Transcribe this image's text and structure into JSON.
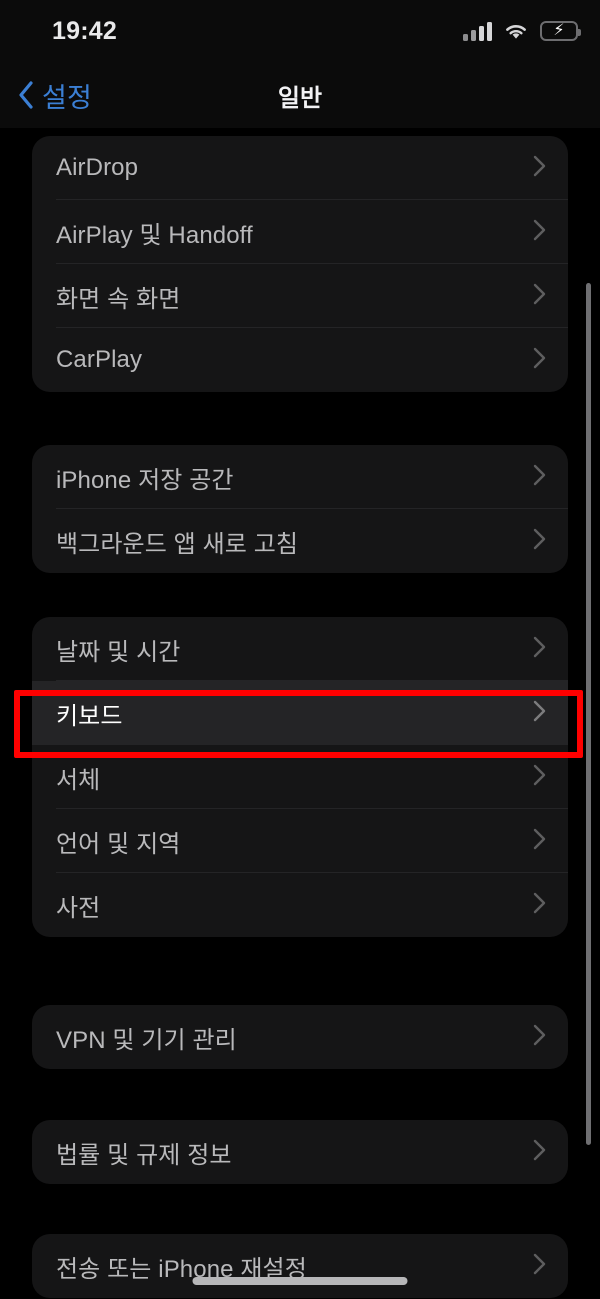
{
  "status_bar": {
    "time": "19:42",
    "cellular_icon": "cellular-bars-icon",
    "cellular_bars": 3,
    "wifi_icon": "wifi-icon",
    "battery_icon": "battery-charging-icon",
    "battery_level_percent": 88,
    "battery_charging": true,
    "battery_color": "#34c759"
  },
  "nav_bar": {
    "back_icon": "chevron-left-icon",
    "back_label": "설정",
    "title": "일반",
    "accent_color": "#3b7fd4"
  },
  "annotation": {
    "type": "red-rectangle-highlight",
    "target_row": "키보드",
    "color": "#ff0000"
  },
  "chevron_icon": "chevron-right-icon",
  "groups": [
    {
      "name": "connectivity-group",
      "rows": [
        {
          "label": "AirDrop",
          "highlighted": false
        },
        {
          "label": "AirPlay 및 Handoff",
          "highlighted": false
        },
        {
          "label": "화면 속 화면",
          "highlighted": false
        },
        {
          "label": "CarPlay",
          "highlighted": false
        }
      ]
    },
    {
      "name": "storage-group",
      "rows": [
        {
          "label": "iPhone 저장 공간",
          "highlighted": false
        },
        {
          "label": "백그라운드 앱 새로 고침",
          "highlighted": false
        }
      ]
    },
    {
      "name": "localization-group",
      "rows": [
        {
          "label": "날짜 및 시간",
          "highlighted": false
        },
        {
          "label": "키보드",
          "highlighted": true
        },
        {
          "label": "서체",
          "highlighted": false
        },
        {
          "label": "언어 및 지역",
          "highlighted": false
        },
        {
          "label": "사전",
          "highlighted": false
        }
      ]
    },
    {
      "name": "vpn-group",
      "rows": [
        {
          "label": "VPN 및 기기 관리",
          "highlighted": false
        }
      ]
    },
    {
      "name": "legal-group",
      "rows": [
        {
          "label": "법률 및 규제 정보",
          "highlighted": false
        }
      ]
    },
    {
      "name": "reset-group",
      "rows": [
        {
          "label": "전송 또는 iPhone 재설정",
          "highlighted": false
        }
      ]
    }
  ],
  "scroll_indicator": {
    "name": "scrollbar"
  },
  "home_indicator": {
    "name": "home-indicator"
  }
}
